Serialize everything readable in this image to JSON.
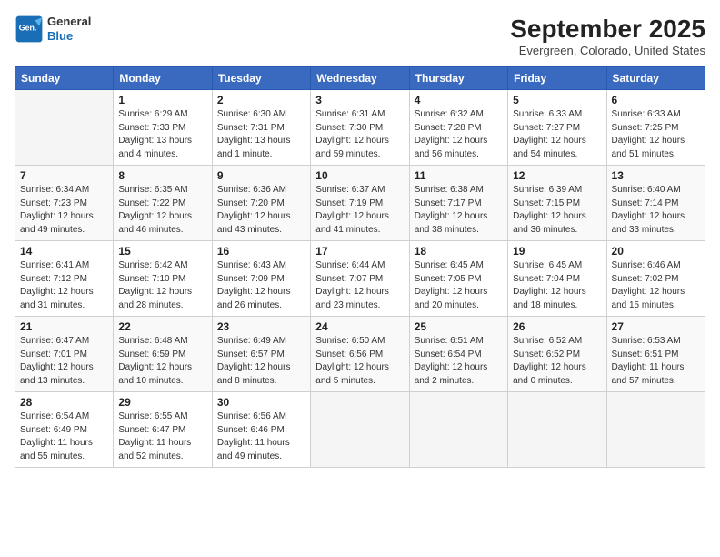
{
  "header": {
    "logo_general": "General",
    "logo_blue": "Blue",
    "month_title": "September 2025",
    "location": "Evergreen, Colorado, United States"
  },
  "weekdays": [
    "Sunday",
    "Monday",
    "Tuesday",
    "Wednesday",
    "Thursday",
    "Friday",
    "Saturday"
  ],
  "weeks": [
    [
      {
        "day": "",
        "info": ""
      },
      {
        "day": "1",
        "info": "Sunrise: 6:29 AM\nSunset: 7:33 PM\nDaylight: 13 hours\nand 4 minutes."
      },
      {
        "day": "2",
        "info": "Sunrise: 6:30 AM\nSunset: 7:31 PM\nDaylight: 13 hours\nand 1 minute."
      },
      {
        "day": "3",
        "info": "Sunrise: 6:31 AM\nSunset: 7:30 PM\nDaylight: 12 hours\nand 59 minutes."
      },
      {
        "day": "4",
        "info": "Sunrise: 6:32 AM\nSunset: 7:28 PM\nDaylight: 12 hours\nand 56 minutes."
      },
      {
        "day": "5",
        "info": "Sunrise: 6:33 AM\nSunset: 7:27 PM\nDaylight: 12 hours\nand 54 minutes."
      },
      {
        "day": "6",
        "info": "Sunrise: 6:33 AM\nSunset: 7:25 PM\nDaylight: 12 hours\nand 51 minutes."
      }
    ],
    [
      {
        "day": "7",
        "info": "Sunrise: 6:34 AM\nSunset: 7:23 PM\nDaylight: 12 hours\nand 49 minutes."
      },
      {
        "day": "8",
        "info": "Sunrise: 6:35 AM\nSunset: 7:22 PM\nDaylight: 12 hours\nand 46 minutes."
      },
      {
        "day": "9",
        "info": "Sunrise: 6:36 AM\nSunset: 7:20 PM\nDaylight: 12 hours\nand 43 minutes."
      },
      {
        "day": "10",
        "info": "Sunrise: 6:37 AM\nSunset: 7:19 PM\nDaylight: 12 hours\nand 41 minutes."
      },
      {
        "day": "11",
        "info": "Sunrise: 6:38 AM\nSunset: 7:17 PM\nDaylight: 12 hours\nand 38 minutes."
      },
      {
        "day": "12",
        "info": "Sunrise: 6:39 AM\nSunset: 7:15 PM\nDaylight: 12 hours\nand 36 minutes."
      },
      {
        "day": "13",
        "info": "Sunrise: 6:40 AM\nSunset: 7:14 PM\nDaylight: 12 hours\nand 33 minutes."
      }
    ],
    [
      {
        "day": "14",
        "info": "Sunrise: 6:41 AM\nSunset: 7:12 PM\nDaylight: 12 hours\nand 31 minutes."
      },
      {
        "day": "15",
        "info": "Sunrise: 6:42 AM\nSunset: 7:10 PM\nDaylight: 12 hours\nand 28 minutes."
      },
      {
        "day": "16",
        "info": "Sunrise: 6:43 AM\nSunset: 7:09 PM\nDaylight: 12 hours\nand 26 minutes."
      },
      {
        "day": "17",
        "info": "Sunrise: 6:44 AM\nSunset: 7:07 PM\nDaylight: 12 hours\nand 23 minutes."
      },
      {
        "day": "18",
        "info": "Sunrise: 6:45 AM\nSunset: 7:05 PM\nDaylight: 12 hours\nand 20 minutes."
      },
      {
        "day": "19",
        "info": "Sunrise: 6:45 AM\nSunset: 7:04 PM\nDaylight: 12 hours\nand 18 minutes."
      },
      {
        "day": "20",
        "info": "Sunrise: 6:46 AM\nSunset: 7:02 PM\nDaylight: 12 hours\nand 15 minutes."
      }
    ],
    [
      {
        "day": "21",
        "info": "Sunrise: 6:47 AM\nSunset: 7:01 PM\nDaylight: 12 hours\nand 13 minutes."
      },
      {
        "day": "22",
        "info": "Sunrise: 6:48 AM\nSunset: 6:59 PM\nDaylight: 12 hours\nand 10 minutes."
      },
      {
        "day": "23",
        "info": "Sunrise: 6:49 AM\nSunset: 6:57 PM\nDaylight: 12 hours\nand 8 minutes."
      },
      {
        "day": "24",
        "info": "Sunrise: 6:50 AM\nSunset: 6:56 PM\nDaylight: 12 hours\nand 5 minutes."
      },
      {
        "day": "25",
        "info": "Sunrise: 6:51 AM\nSunset: 6:54 PM\nDaylight: 12 hours\nand 2 minutes."
      },
      {
        "day": "26",
        "info": "Sunrise: 6:52 AM\nSunset: 6:52 PM\nDaylight: 12 hours\nand 0 minutes."
      },
      {
        "day": "27",
        "info": "Sunrise: 6:53 AM\nSunset: 6:51 PM\nDaylight: 11 hours\nand 57 minutes."
      }
    ],
    [
      {
        "day": "28",
        "info": "Sunrise: 6:54 AM\nSunset: 6:49 PM\nDaylight: 11 hours\nand 55 minutes."
      },
      {
        "day": "29",
        "info": "Sunrise: 6:55 AM\nSunset: 6:47 PM\nDaylight: 11 hours\nand 52 minutes."
      },
      {
        "day": "30",
        "info": "Sunrise: 6:56 AM\nSunset: 6:46 PM\nDaylight: 11 hours\nand 49 minutes."
      },
      {
        "day": "",
        "info": ""
      },
      {
        "day": "",
        "info": ""
      },
      {
        "day": "",
        "info": ""
      },
      {
        "day": "",
        "info": ""
      }
    ]
  ]
}
